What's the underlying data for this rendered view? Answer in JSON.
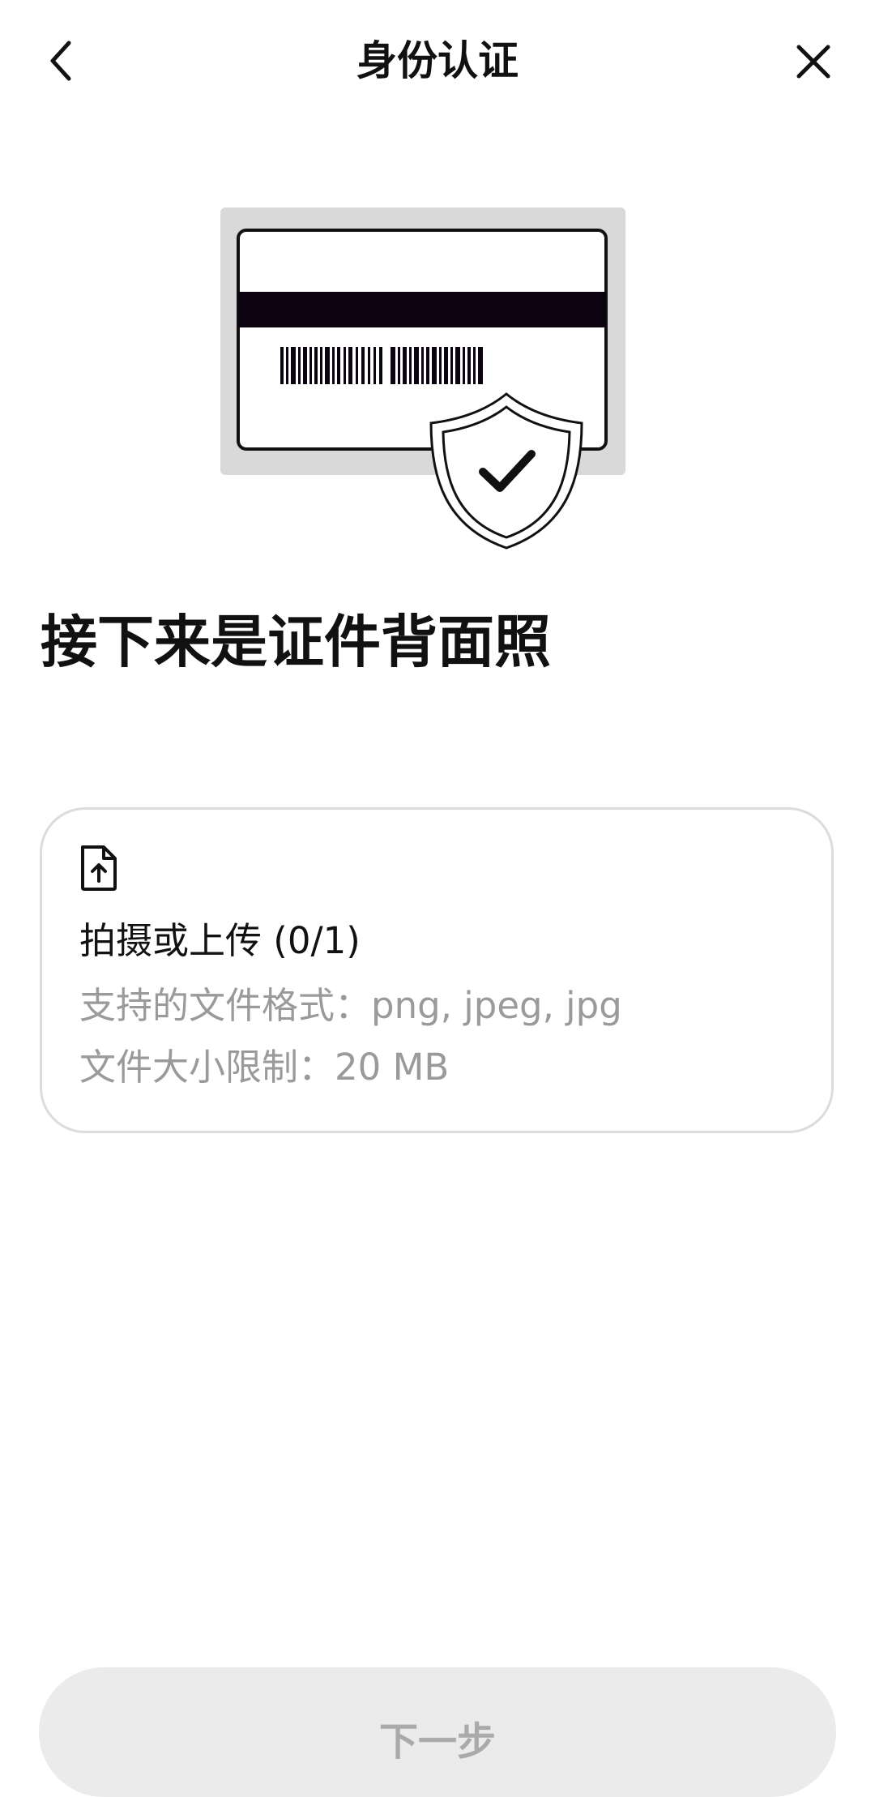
{
  "header": {
    "title": "身份认证",
    "back_icon": "chevron-left-icon",
    "close_icon": "close-icon"
  },
  "illustration": {
    "icon": "id-card-back-with-shield-check-illustration"
  },
  "main": {
    "heading": "接下来是证件背面照"
  },
  "upload": {
    "icon": "file-upload-icon",
    "title": "拍摄或上传 (0/1)",
    "formats": "支持的文件格式：png, jpeg, jpg",
    "size_limit": "文件大小限制：20 MB"
  },
  "footer": {
    "next_label": "下一步",
    "next_state": "disabled"
  },
  "colors": {
    "background": "#ffffff",
    "text_primary": "#111111",
    "text_secondary": "#9a9a9a",
    "card_border": "#dcdcdc",
    "button_disabled_bg": "#ebebeb",
    "button_disabled_text": "#aaaaaa"
  }
}
